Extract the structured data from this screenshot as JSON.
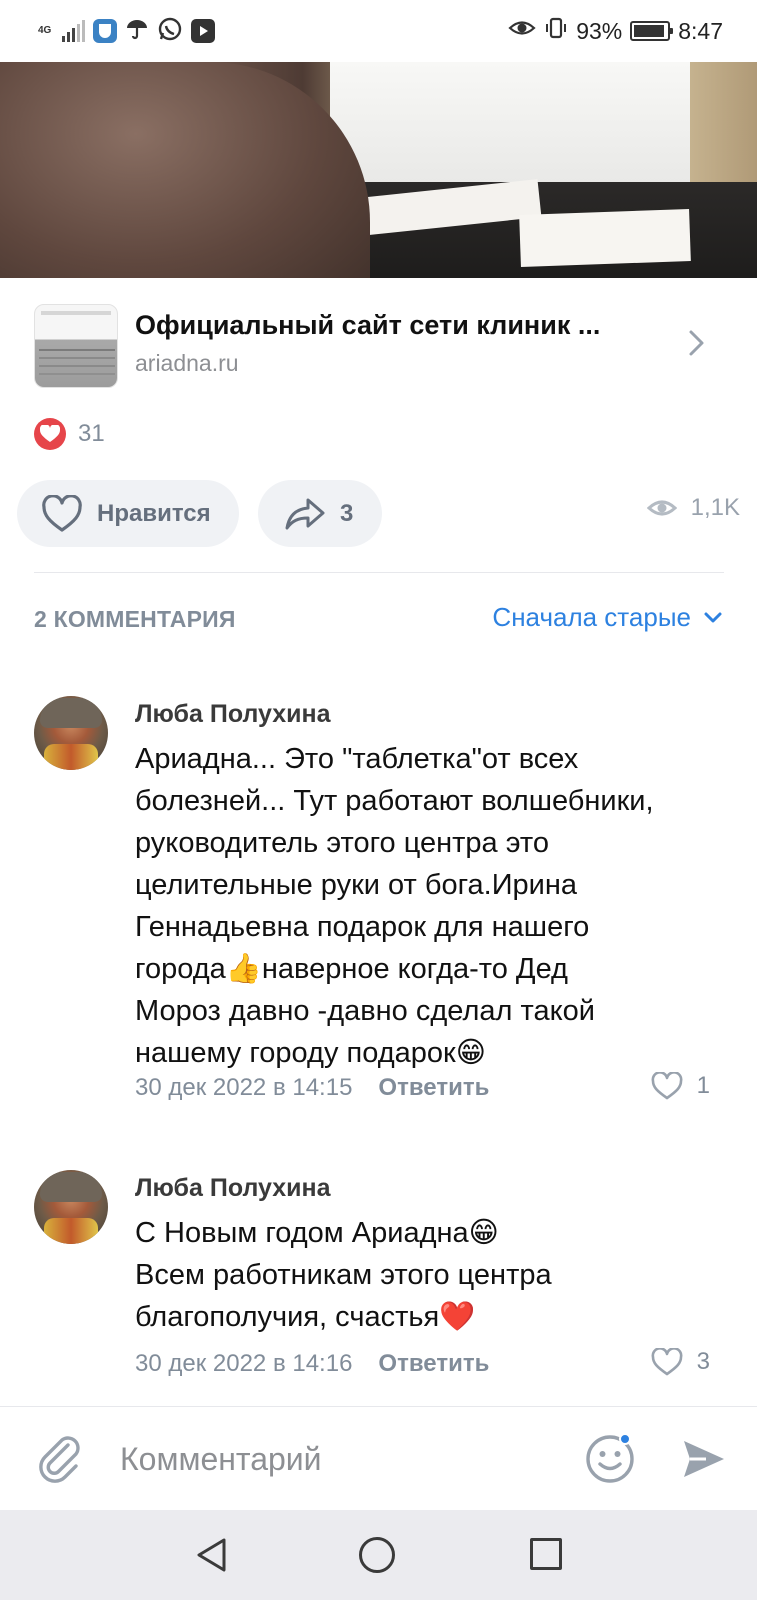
{
  "status_bar": {
    "network": "4G",
    "battery": "93%",
    "time": "8:47",
    "battery_level": 0.93,
    "icons": [
      "signal-icon",
      "vpn-shield-icon",
      "umbrella-icon",
      "whatsapp-icon",
      "youtube-icon",
      "eye-icon",
      "vibrate-icon",
      "battery-icon"
    ]
  },
  "link_card": {
    "title": "Официальный сайт сети клиник ...",
    "domain": "ariadna.ru"
  },
  "reactions": {
    "count": "31"
  },
  "actions": {
    "like_label": "Нравится",
    "share_count": "3",
    "views": "1,1K"
  },
  "comments_header": {
    "count_label": "2 КОММЕНТАРИЯ",
    "sort_label": "Сначала старые"
  },
  "comments": [
    {
      "author": "Люба Полухина",
      "text": "Ариадна... Это \"таблетка\"от всех\nболезней... Тут работают волшебники,\nруководитель этого центра это\nцелительные руки от бога.Ирина\nГеннадьевна  подарок для нашего\nгорода👍наверное когда-то Дед\nМороз давно -давно сделал такой\nнашему городу подарок😁",
      "date": "30 дек 2022 в 14:15",
      "reply_label": "Ответить",
      "likes": "1"
    },
    {
      "author": "Люба Полухина",
      "text": "С Новым годом Ариадна😁\nВсем работникам этого центра\nблагополучия, счастья❤️",
      "date": "30 дек 2022 в 14:16",
      "reply_label": "Ответить",
      "likes": "3"
    }
  ],
  "composer": {
    "placeholder": "Комментарий"
  },
  "colors": {
    "accent": "#2d81e0",
    "like_red": "#e6454a",
    "secondary_text": "#818c99",
    "button_bg": "#f0f2f5",
    "navbar_bg": "#ebebef"
  }
}
